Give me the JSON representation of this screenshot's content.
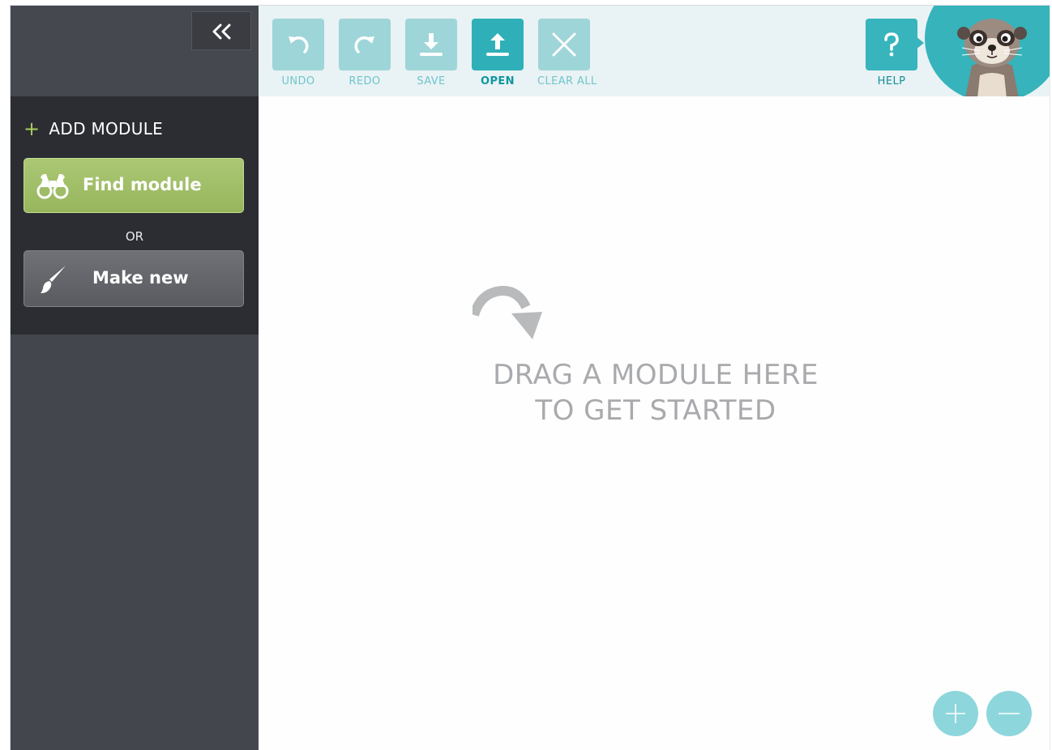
{
  "sidebar": {
    "collapse_icon": "double-chevron-left-icon",
    "add_module_label": "ADD MODULE",
    "add_module_icon": "plus-icon",
    "find_module_label": "Find module",
    "find_module_icon": "binoculars-icon",
    "or_label": "OR",
    "make_new_label": "Make new",
    "make_new_icon": "paintbrush-icon"
  },
  "toolbar": {
    "undo_label": "UNDO",
    "redo_label": "REDO",
    "save_label": "SAVE",
    "open_label": "OPEN",
    "clear_all_label": "CLEAR ALL",
    "help_label": "HELP",
    "active_tool": "OPEN"
  },
  "canvas": {
    "drop_line1": "DRAG A MODULE HERE",
    "drop_line2": "TO GET STARTED",
    "drop_icon": "curved-arrow-icon",
    "zoom_in_icon": "plus-icon",
    "zoom_out_icon": "minus-icon"
  },
  "colors": {
    "sidebar_bg": "#44464d",
    "panel_bg": "#2b2d33",
    "find_green": "#a3c06b",
    "accent_teal": "#2fb0b8",
    "toolbar_bg": "#e9f2f4"
  }
}
